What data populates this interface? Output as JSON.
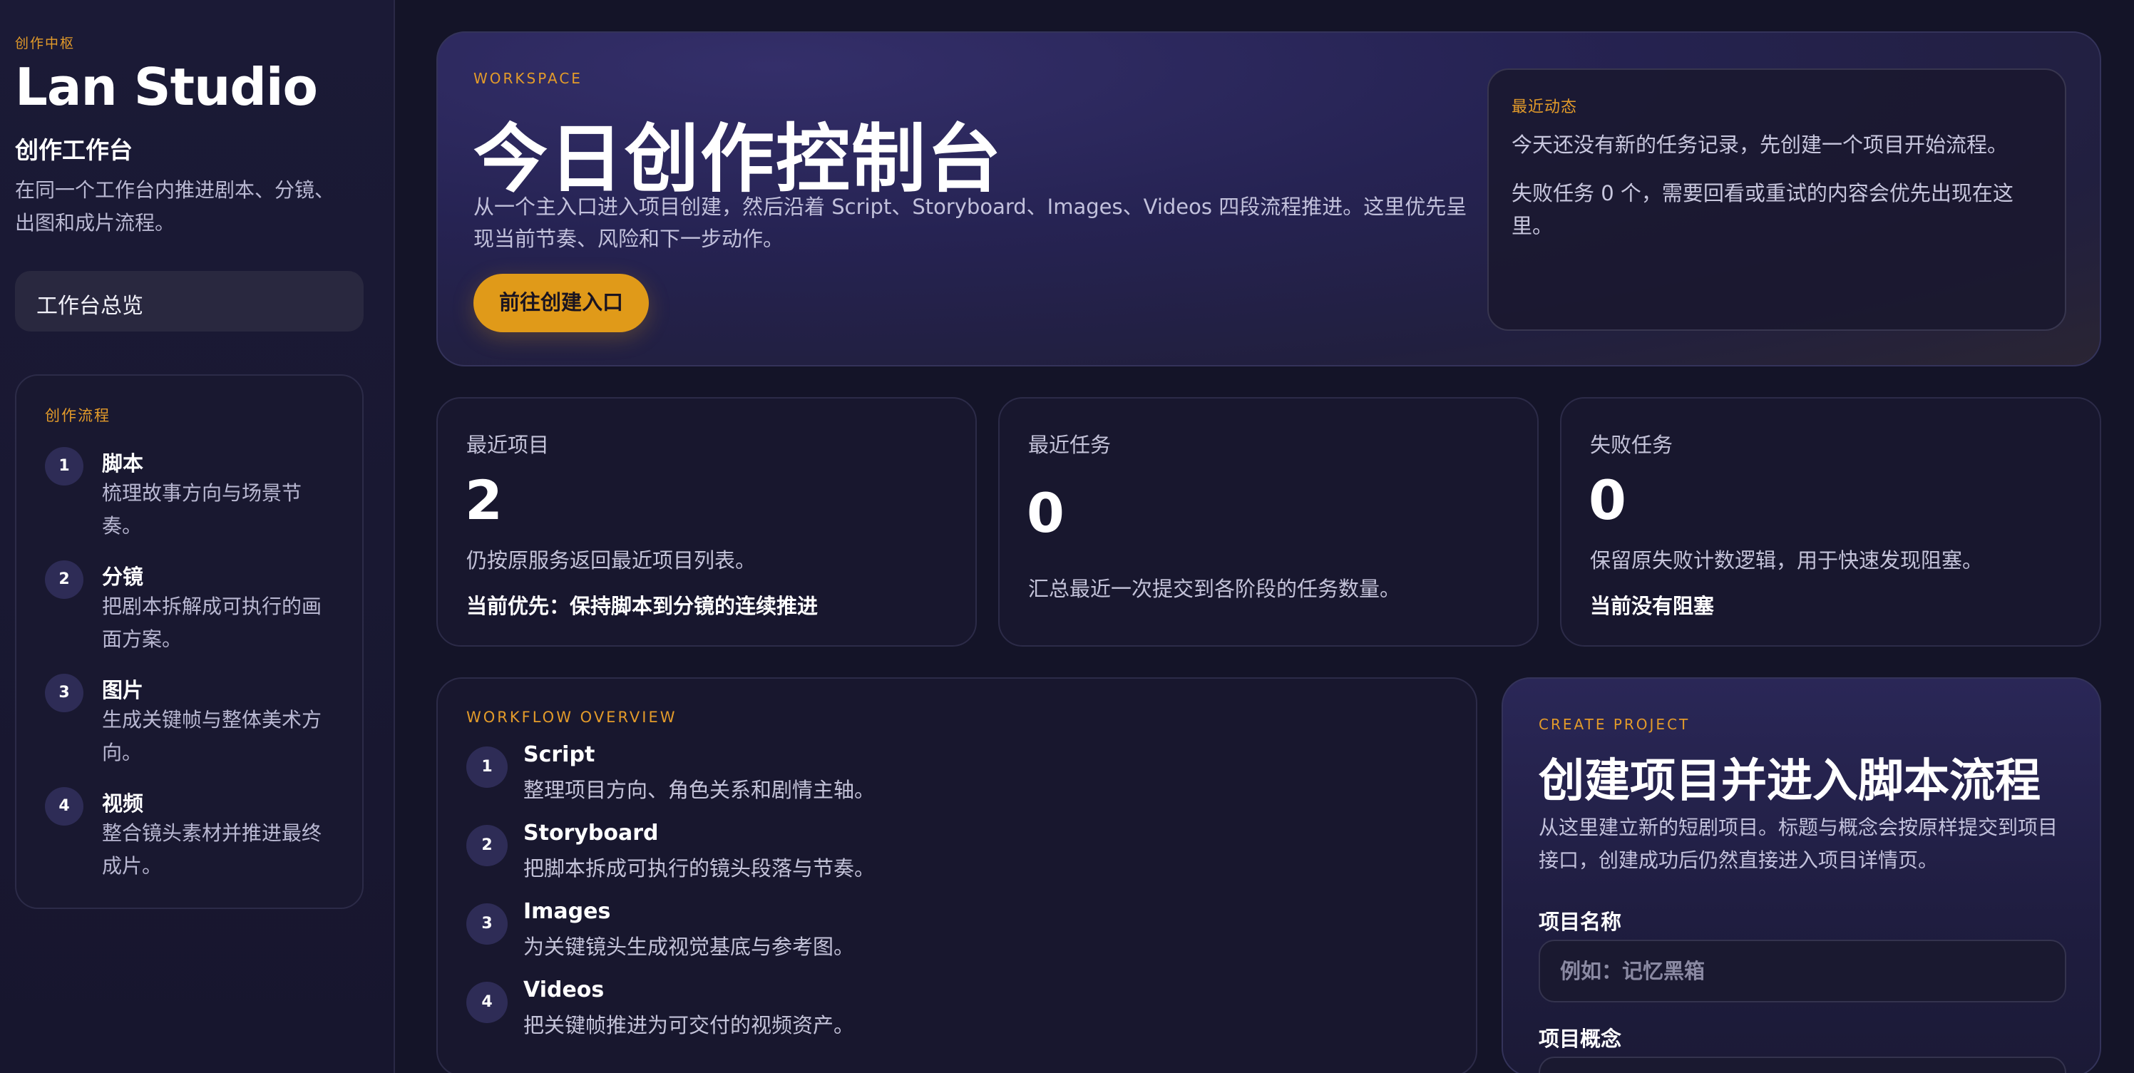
{
  "sidebar": {
    "eyebrow": "创作中枢",
    "title": "Lan Studio",
    "subtitle": "创作工作台",
    "description": "在同一个工作台内推进剧本、分镜、出图和成片流程。",
    "nav_item": "工作台总览",
    "flow": {
      "eyebrow": "创作流程",
      "steps": [
        {
          "num": "1",
          "title": "脚本",
          "desc": "梳理故事方向与场景节奏。"
        },
        {
          "num": "2",
          "title": "分镜",
          "desc": "把剧本拆解成可执行的画面方案。"
        },
        {
          "num": "3",
          "title": "图片",
          "desc": "生成关键帧与整体美术方向。"
        },
        {
          "num": "4",
          "title": "视频",
          "desc": "整合镜头素材并推进最终成片。"
        }
      ]
    }
  },
  "hero": {
    "eyebrow": "WORKSPACE",
    "title": "今日创作控制台",
    "description": "从一个主入口进入项目创建，然后沿着 Script、Storyboard、Images、Videos 四段流程推进。这里优先呈现当前节奏、风险和下一步动作。",
    "button": "前往创建入口",
    "recent": {
      "eyebrow": "最近动态",
      "line1": "今天还没有新的任务记录，先创建一个项目开始流程。",
      "line2": "失败任务 0 个，需要回看或重试的内容会优先出现在这里。"
    }
  },
  "stats": [
    {
      "label": "最近项目",
      "value": "2",
      "desc": "仍按原服务返回最近项目列表。",
      "note": "当前优先：保持脚本到分镜的连续推进"
    },
    {
      "label": "最近任务",
      "value": "0",
      "desc": "汇总最近一次提交到各阶段的任务数量。",
      "note": ""
    },
    {
      "label": "失败任务",
      "value": "0",
      "desc": "保留原失败计数逻辑，用于快速发现阻塞。",
      "note": "当前没有阻塞"
    }
  ],
  "workflow": {
    "eyebrow": "WORKFLOW OVERVIEW",
    "steps": [
      {
        "num": "1",
        "title": "Script",
        "desc": "整理项目方向、角色关系和剧情主轴。"
      },
      {
        "num": "2",
        "title": "Storyboard",
        "desc": "把脚本拆成可执行的镜头段落与节奏。"
      },
      {
        "num": "3",
        "title": "Images",
        "desc": "为关键镜头生成视觉基底与参考图。"
      },
      {
        "num": "4",
        "title": "Videos",
        "desc": "把关键帧推进为可交付的视频资产。"
      }
    ]
  },
  "create_project": {
    "eyebrow": "CREATE PROJECT",
    "title": "创建项目并进入脚本流程",
    "description": "从这里建立新的短剧项目。标题与概念会按原样提交到项目接口，创建成功后仍然直接进入项目详情页。",
    "name_label": "项目名称",
    "name_placeholder": "例如：记忆黑箱",
    "concept_label": "项目概念"
  },
  "colors": {
    "accent": "#e09a19",
    "background": "#141428",
    "card": "#18172e"
  }
}
